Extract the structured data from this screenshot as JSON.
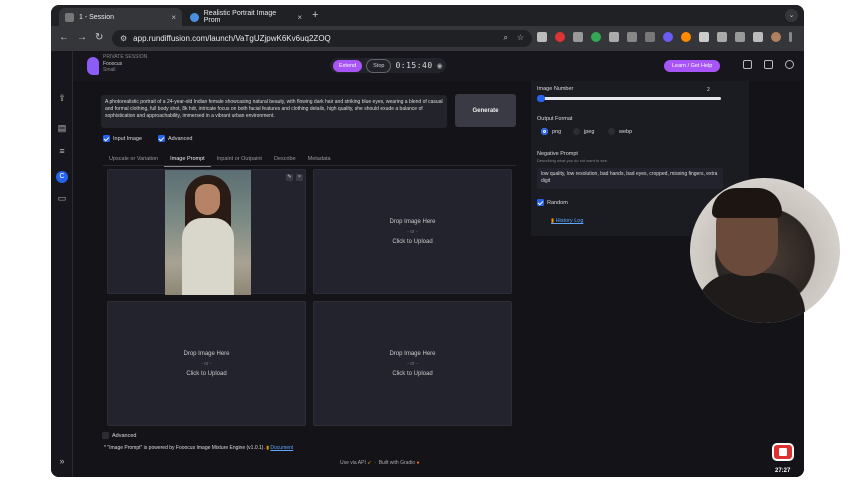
{
  "browser": {
    "tabs": [
      {
        "title": "1 - Session",
        "active": true
      },
      {
        "title": "Realistic Portrait Image Prom",
        "active": false
      }
    ],
    "url": "app.rundiffusion.com/launch/VaTgUZjpwK6Kv6uq2ZOQ"
  },
  "header": {
    "session_label": "PRIVATE SESSION",
    "app_name": "Fooocus",
    "size": "Small",
    "extend_label": "Extend",
    "stop_label": "Stop",
    "timer": "0:15:40",
    "help_label": "Learn / Get Help"
  },
  "prompt": {
    "text": "A photorealistic portrait of a 24-year-old Indian female showcasing natural beauty, with flowing dark hair and striking blue eyes, wearing a blend of casual and formal clothing, full body shot, 8k hdr, intricate focus on both facial features and clothing details, high quality, she should exude a balance of sophistication and approachability, immersed in a vibrant urban environment.",
    "generate_label": "Generate"
  },
  "options": {
    "input_image_label": "Input Image",
    "advanced_label": "Advanced"
  },
  "tabs": [
    "Upscale or Variation",
    "Image Prompt",
    "Inpaint or Outpaint",
    "Describe",
    "Metadata"
  ],
  "upload": {
    "drop": "Drop Image Here",
    "or": "- or -",
    "click": "Click to Upload"
  },
  "advanced_bottom_label": "Advanced",
  "footnote": {
    "text": "* \"Image Prompt\" is powered by Fooocus Image Mixture Engine (v1.0.1).",
    "link": "Document"
  },
  "right_panel": {
    "image_number_label": "Image Number",
    "image_number_value": "2",
    "image_number_fraction": 0.0,
    "output_format_label": "Output Format",
    "formats": [
      "png",
      "jpeg",
      "webp"
    ],
    "selected_format": "png",
    "negative_prompt_label": "Negative Prompt",
    "negative_prompt_desc": "Describing what you do not want to see.",
    "negative_prompt_text": "low quality, low resolution, bad hands, bad eyes, cropped, missing fingers, extra digit",
    "random_label": "Random",
    "history_log": "History Log"
  },
  "footer": {
    "api": "Use via API",
    "built": "Built with Gradio"
  },
  "recording_time": "27:27",
  "colors": {
    "accent": "#2563eb",
    "brand": "#a855f7",
    "record": "#e03131"
  }
}
